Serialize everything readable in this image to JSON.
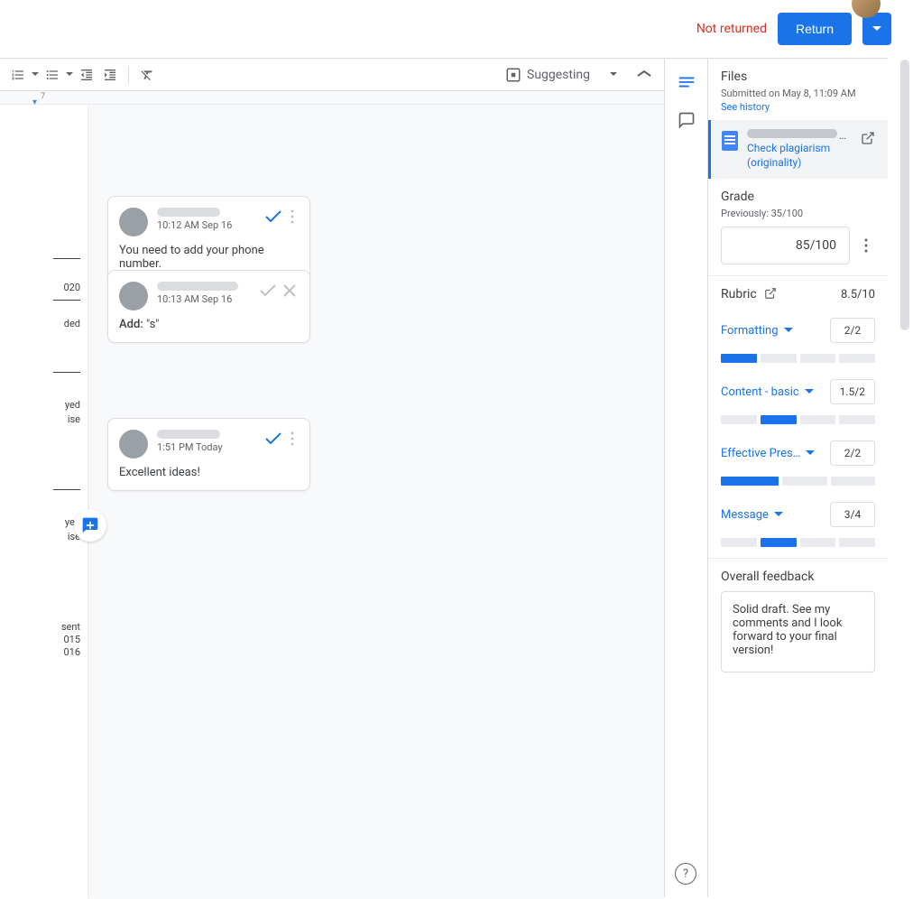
{
  "header": {
    "status": "Not returned",
    "return_label": "Return"
  },
  "toolbar": {
    "mode": "Suggesting"
  },
  "ruler": {
    "marks": [
      "7"
    ]
  },
  "doc_fragments": {
    "line1": "020",
    "line2": "ded",
    "line3": "yed",
    "line4": "ise",
    "line5": "yed",
    "line6": "ise",
    "line7": "sent",
    "line8": "015",
    "line9": "016"
  },
  "comments": [
    {
      "time": "10:12 AM Sep 16",
      "body": "You need to add your phone number.",
      "type": "comment"
    },
    {
      "time": "10:13 AM Sep 16",
      "prefix": "Add:",
      "body": "\"s\"",
      "type": "suggestion"
    },
    {
      "time": "1:51 PM Today",
      "body": "Excellent ideas!",
      "type": "comment"
    }
  ],
  "files": {
    "title": "Files",
    "submitted": "Submitted on May 8, 11:09 AM",
    "history": "See history",
    "plagiarism": "Check plagiarism (originality)"
  },
  "grade": {
    "title": "Grade",
    "previously": "Previously: 35/100",
    "value": "85/100"
  },
  "rubric": {
    "title": "Rubric",
    "total": "8.5/10",
    "criteria": [
      {
        "name": "Formatting",
        "score": "2/2",
        "bars": 4,
        "filled": 0
      },
      {
        "name": "Content - basic",
        "score": "1.5/2",
        "bars": 4,
        "filled": 1
      },
      {
        "name": "Effective Pres…",
        "score": "2/2",
        "bars": 3,
        "filled": 0
      },
      {
        "name": "Message",
        "score": "3/4",
        "bars": 4,
        "filled": 1
      }
    ]
  },
  "feedback": {
    "title": "Overall feedback",
    "text": "Solid draft. See my comments and I look forward to your final version!"
  }
}
